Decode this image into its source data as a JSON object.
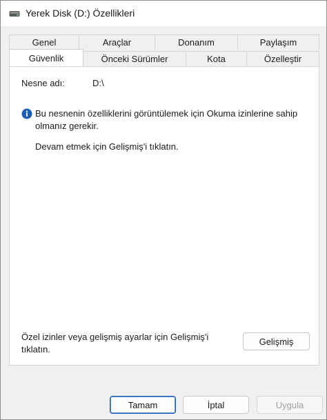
{
  "window": {
    "title": "Yerek Disk (D:) Özellikleri",
    "title_icon": "drive-icon"
  },
  "tabs": {
    "row_back": [
      "Genel",
      "Araçlar",
      "Donanım",
      "Paylaşım"
    ],
    "row_front": [
      "Güvenlik",
      "Önceki Sürümler",
      "Kota",
      "Özelleştir"
    ],
    "active": "Güvenlik"
  },
  "security": {
    "object_name_label": "Nesne adı:",
    "object_name_value": "D:\\",
    "info_icon": "info-icon",
    "info_line1": "Bu nesnenin özelliklerini görüntülemek için Okuma izinlerine sahip",
    "info_line2": "olmanız gerekir.",
    "continue_text": "Devam etmek için Gelişmiş'i tıklatın.",
    "advanced_hint_line1": "Özel izinler veya gelişmiş ayarlar için Gelişmiş'i",
    "advanced_hint_line2": "tıklatın.",
    "advanced_button": "Gelişmiş"
  },
  "footer": {
    "ok_button": "Tamam",
    "cancel_button": "İptal",
    "apply_button": "Uygula"
  },
  "colors": {
    "accent": "#1c5db3",
    "info_icon": "#1a5fb4"
  }
}
